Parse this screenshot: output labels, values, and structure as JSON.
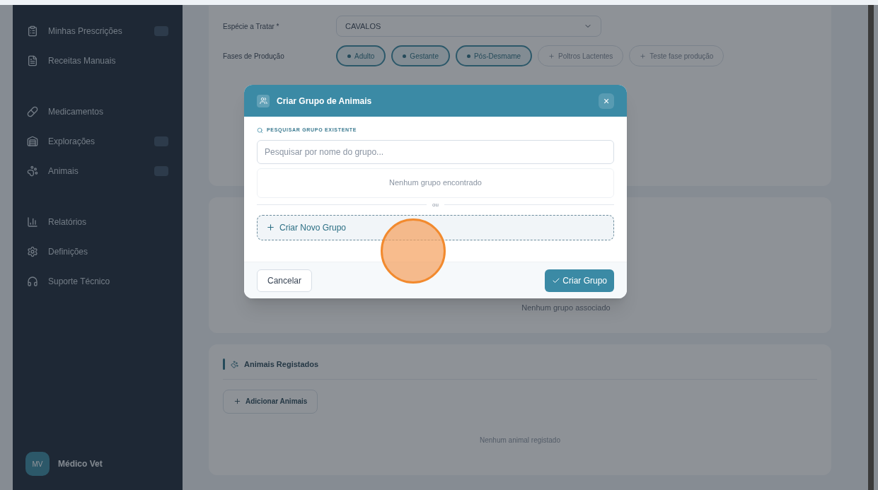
{
  "sidebar": {
    "items": [
      {
        "label": "Minhas Prescrições",
        "badge": true
      },
      {
        "label": "Receitas Manuais",
        "badge": false
      },
      {
        "label": "Medicamentos",
        "badge": false
      },
      {
        "label": "Explorações",
        "badge": true
      },
      {
        "label": "Animais",
        "badge": true
      },
      {
        "label": "Relatórios",
        "badge": false
      },
      {
        "label": "Definições",
        "badge": false
      },
      {
        "label": "Suporte Técnico",
        "badge": false
      }
    ],
    "user": {
      "initials": "MV",
      "name": "Médico Vet"
    }
  },
  "form": {
    "species_label": "Espécie a Tratar *",
    "species_value": "CAVALOS",
    "phases_label": "Fases de Produção",
    "phases": [
      {
        "label": "Adulto",
        "selected": true
      },
      {
        "label": "Gestante",
        "selected": true
      },
      {
        "label": "Pós-Desmame",
        "selected": true
      },
      {
        "label": "Poltros Lactentes",
        "selected": false
      },
      {
        "label": "Teste fase produção",
        "selected": false
      }
    ]
  },
  "groups_card": {
    "empty": "Nenhum grupo associado"
  },
  "animals_card": {
    "title": "Animais Registados",
    "add_button": "Adicionar Animais",
    "empty": "Nenhum animal registado"
  },
  "modal": {
    "title": "Criar Grupo de Animais",
    "close": "×",
    "search_label": "PESQUISAR GRUPO EXISTENTE",
    "search_placeholder": "Pesquisar por nome do grupo...",
    "no_results": "Nenhum grupo encontrado",
    "divider": "ou",
    "create_new": "Criar Novo Grupo",
    "cancel": "Cancelar",
    "submit": "Criar Grupo"
  }
}
